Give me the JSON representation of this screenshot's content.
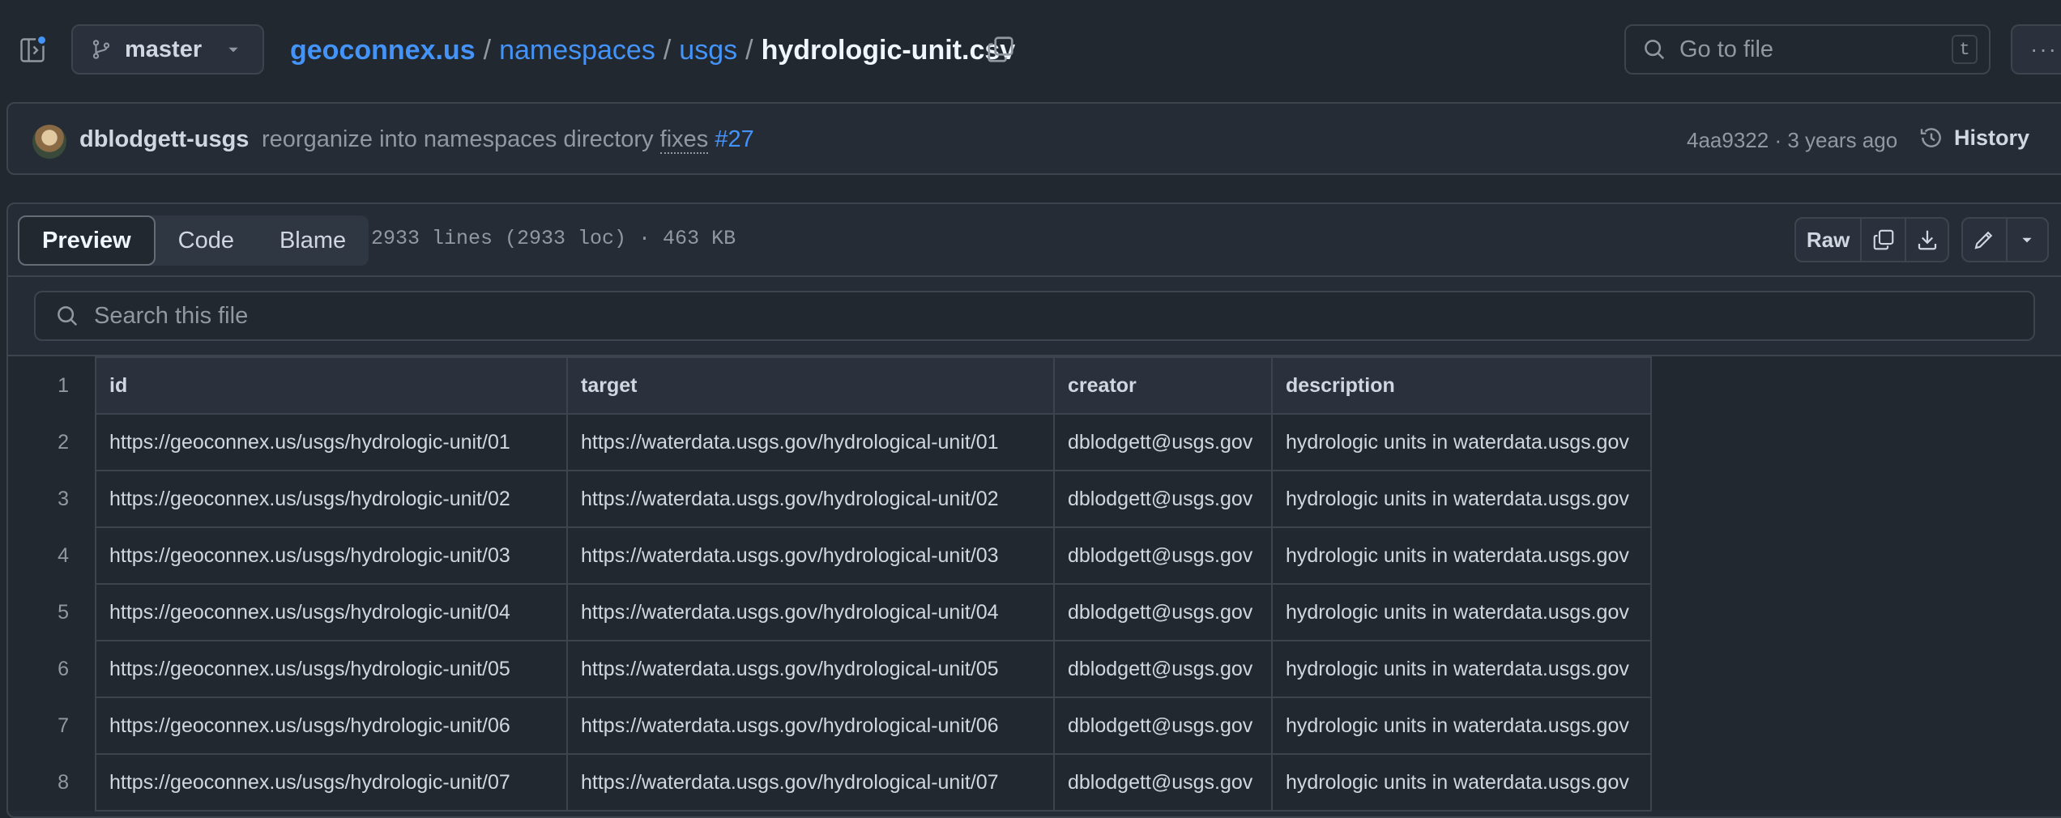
{
  "header": {
    "branch": "master",
    "breadcrumb": {
      "repo": "geoconnex.us",
      "dir1": "namespaces",
      "dir2": "usgs",
      "file": "hydrologic-unit.csv",
      "sep": "/"
    },
    "goto_placeholder": "Go to file",
    "goto_shortcut": "t",
    "more": "···"
  },
  "commit": {
    "author": "dblodgett-usgs",
    "message": "reorganize into namespaces directory",
    "fixes": "fixes",
    "issue": "#27",
    "meta": "4aa9322 · 3 years ago",
    "history": "History"
  },
  "file": {
    "tabs": [
      "Preview",
      "Code",
      "Blame"
    ],
    "info": "2933 lines (2933 loc) · 463 KB",
    "raw": "Raw",
    "search_placeholder": "Search this file"
  },
  "table": {
    "header_line": "1",
    "columns": [
      "id",
      "target",
      "creator",
      "description"
    ],
    "rows": [
      {
        "line": "2",
        "cells": [
          "https://geoconnex.us/usgs/hydrologic-unit/01",
          "https://waterdata.usgs.gov/hydrological-unit/01",
          "dblodgett@usgs.gov",
          "hydrologic units in waterdata.usgs.gov"
        ]
      },
      {
        "line": "3",
        "cells": [
          "https://geoconnex.us/usgs/hydrologic-unit/02",
          "https://waterdata.usgs.gov/hydrological-unit/02",
          "dblodgett@usgs.gov",
          "hydrologic units in waterdata.usgs.gov"
        ]
      },
      {
        "line": "4",
        "cells": [
          "https://geoconnex.us/usgs/hydrologic-unit/03",
          "https://waterdata.usgs.gov/hydrological-unit/03",
          "dblodgett@usgs.gov",
          "hydrologic units in waterdata.usgs.gov"
        ]
      },
      {
        "line": "5",
        "cells": [
          "https://geoconnex.us/usgs/hydrologic-unit/04",
          "https://waterdata.usgs.gov/hydrological-unit/04",
          "dblodgett@usgs.gov",
          "hydrologic units in waterdata.usgs.gov"
        ]
      },
      {
        "line": "6",
        "cells": [
          "https://geoconnex.us/usgs/hydrologic-unit/05",
          "https://waterdata.usgs.gov/hydrological-unit/05",
          "dblodgett@usgs.gov",
          "hydrologic units in waterdata.usgs.gov"
        ]
      },
      {
        "line": "7",
        "cells": [
          "https://geoconnex.us/usgs/hydrologic-unit/06",
          "https://waterdata.usgs.gov/hydrological-unit/06",
          "dblodgett@usgs.gov",
          "hydrologic units in waterdata.usgs.gov"
        ]
      },
      {
        "line": "8",
        "cells": [
          "https://geoconnex.us/usgs/hydrologic-unit/07",
          "https://waterdata.usgs.gov/hydrological-unit/07",
          "dblodgett@usgs.gov",
          "hydrologic units in waterdata.usgs.gov"
        ]
      }
    ]
  },
  "colors": {
    "background": "#212830",
    "link": "#4493f8",
    "border": "#3d444d",
    "muted": "#9198a1"
  }
}
